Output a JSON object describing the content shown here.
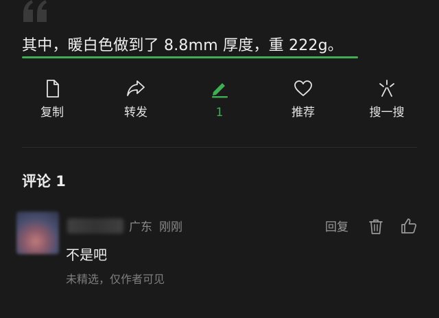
{
  "quote": {
    "text": "其中，暖白色做到了 8.8mm 厚度，重 222g。"
  },
  "actions": [
    {
      "icon": "document-icon",
      "label": "复制"
    },
    {
      "icon": "share-arrow-icon",
      "label": "转发"
    },
    {
      "icon": "pen-underline-icon",
      "label": "1"
    },
    {
      "icon": "heart-icon",
      "label": "推荐"
    },
    {
      "icon": "sparkle-search-icon",
      "label": "搜一搜"
    }
  ],
  "colors": {
    "accent": "#3fae55",
    "background": "#1a1a1a"
  },
  "comments": {
    "title": "评论 1",
    "items": [
      {
        "location": "广东",
        "time": "刚刚",
        "reply_label": "回复",
        "text": "不是吧",
        "note": "未精选，仅作者可见"
      }
    ]
  }
}
